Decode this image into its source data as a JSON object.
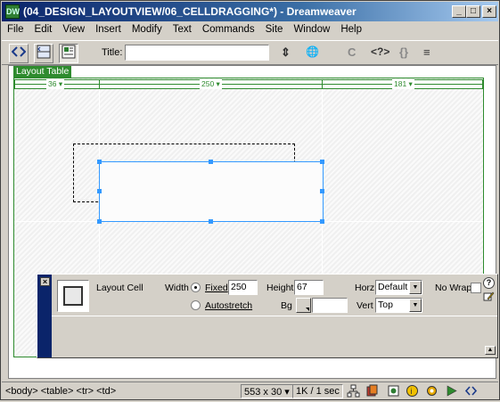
{
  "window": {
    "title": "(04_DESIGN_LAYOUTVIEW/06_CELLDRAGGING*) - Dreamweaver",
    "minimize": "_",
    "maximize": "□",
    "close": "×"
  },
  "menu": [
    "File",
    "Edit",
    "View",
    "Insert",
    "Modify",
    "Text",
    "Commands",
    "Site",
    "Window",
    "Help"
  ],
  "toolbar": {
    "title_label": "Title:",
    "title_value": "",
    "view_buttons": [
      "code-view",
      "split-view",
      "design-view"
    ],
    "glyphs": [
      "⇕",
      "🌐",
      "C",
      "<?>",
      "{}",
      "≡"
    ]
  },
  "layout": {
    "tab_label": "Layout Table",
    "col_widths": [
      "36 ▾",
      "250 ▾",
      "181 ▾"
    ]
  },
  "inspector": {
    "close": "×",
    "cell_label": "Layout Cell",
    "width_label": "Width",
    "fixed_label": "Fixed",
    "fixed_value": "250",
    "autostretch_label": "Autostretch",
    "height_label": "Height",
    "height_value": "67",
    "bg_label": "Bg",
    "bg_value": "",
    "horz_label": "Horz",
    "horz_value": "Default",
    "vert_label": "Vert",
    "vert_value": "Top",
    "nowrap_label": "No Wrap",
    "help": "?",
    "expand": "▲"
  },
  "status": {
    "tag_selector": "<body> <table> <tr> <td>",
    "dimensions": "553 x 30 ▾",
    "download": "1K / 1 sec"
  },
  "colors": {
    "title_gradient_start": "#0a246a",
    "layout_green": "#2e8b2e",
    "selection_blue": "#3399ff"
  }
}
